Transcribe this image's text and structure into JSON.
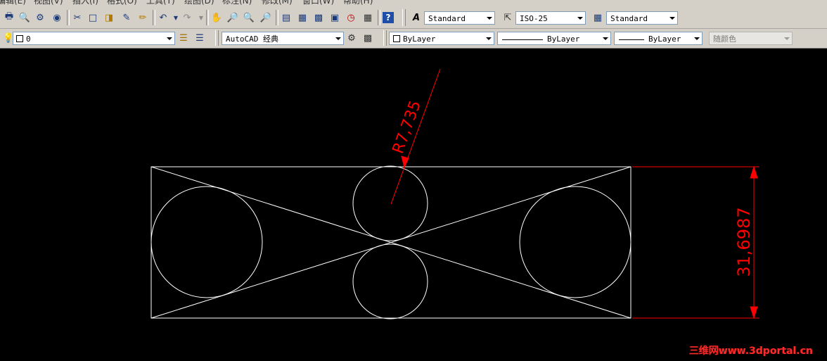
{
  "menubar": {
    "items": [
      "编辑(E)",
      "视图(V)",
      "插入(I)",
      "格式(O)",
      "工具(T)",
      "绘图(D)",
      "标注(N)",
      "修改(M)",
      "窗口(W)",
      "帮助(H)"
    ]
  },
  "toolbar_styles": {
    "text_style": "Standard",
    "dim_style": "ISO-25",
    "table_style": "Standard"
  },
  "toolbar_layers": {
    "layer_name": "0",
    "workspace": "AutoCAD 经典",
    "color": "ByLayer",
    "linetype": "ByLayer",
    "lineweight": "ByLayer",
    "plot_style": "随颜色"
  },
  "icons": {
    "standard": [
      "new-icon",
      "open-icon",
      "save-icon",
      "plot-icon",
      "cut-icon",
      "copy-icon",
      "paste-icon",
      "match-properties-icon",
      "block-editor-icon",
      "undo-icon",
      "redo-icon",
      "pan-icon",
      "zoom-realtime-icon",
      "zoom-window-icon",
      "zoom-previous-icon",
      "properties-icon",
      "design-center-icon",
      "tool-palettes-icon",
      "sheet-set-icon",
      "markup-icon",
      "calculator-icon",
      "help-icon"
    ],
    "styles": [
      "text-style-icon",
      "dim-style-icon",
      "table-style-icon"
    ],
    "layers": [
      "layer-state-icon",
      "layer-manager-icon",
      "layer-previous-icon",
      "workspace-settings-icon",
      "workspace-save-icon"
    ]
  },
  "drawing": {
    "radius_label": "R7,735",
    "height_label": "31,6987",
    "line_color": "#ffffff",
    "dim_color": "#ff0000"
  },
  "watermark": "三维网www.3dportal.cn"
}
